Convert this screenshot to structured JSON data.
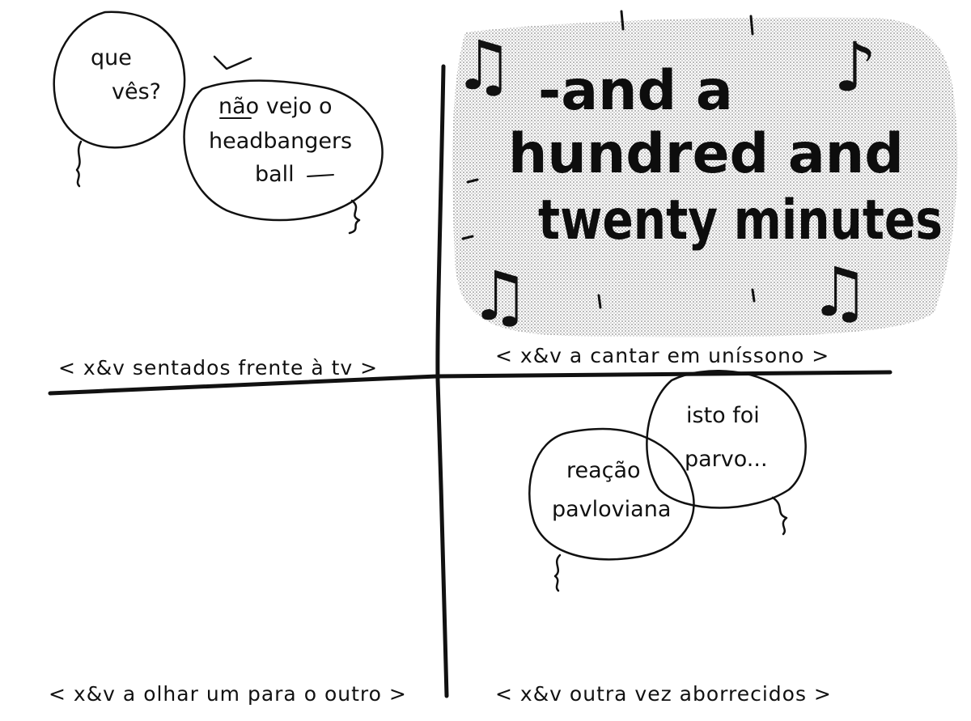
{
  "panels": {
    "top_left": {
      "bubble_question": [
        "que",
        "vês?"
      ],
      "bubble_answer": [
        "não vejo o",
        "headbangers",
        "ball"
      ],
      "caption": "< x&v sentados frente à tv >"
    },
    "top_right": {
      "lyric_lines": [
        "-and a",
        "hundred and",
        "twenty minutes"
      ],
      "caption": "< x&v a cantar em uníssono >",
      "note_icon": "music-note"
    },
    "bottom_left": {
      "caption": "< x&v a olhar um para o outro >"
    },
    "bottom_right": {
      "bubble_left": [
        "reação",
        "pavloviana"
      ],
      "bubble_right": [
        "isto foi",
        "parvo..."
      ],
      "caption": "< x&v outra vez aborrecidos >"
    }
  },
  "colors": {
    "ink": "#111111",
    "background": "#ffffff",
    "screentone": "#8a8a8a"
  }
}
